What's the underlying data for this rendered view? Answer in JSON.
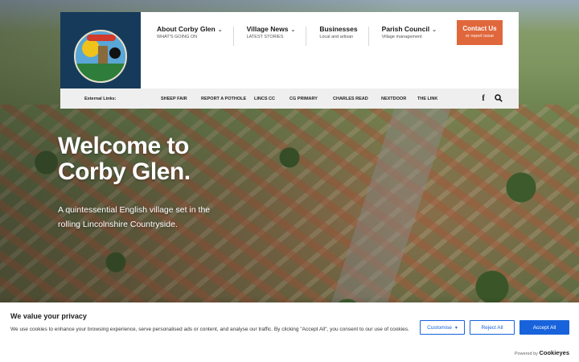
{
  "header": {
    "logo_alt": "Corby Glen village sign",
    "nav": [
      {
        "title": "About Corby Glen",
        "sub": "WHAT'S GOING ON",
        "has_caret": true
      },
      {
        "title": "Village News",
        "sub": "LATEST STORIES",
        "has_caret": true
      },
      {
        "title": "Businesses",
        "sub": "Local and artisan",
        "has_caret": false
      },
      {
        "title": "Parish Council",
        "sub": "Village management",
        "has_caret": true
      }
    ],
    "contact": {
      "title": "Contact Us",
      "sub": "or report issue"
    },
    "external": {
      "label": "External Links:",
      "links": [
        "SHEEP FAIR",
        "Report a pothole",
        "Lincs CC",
        "CG PRIMARY",
        "CHARLES READ",
        "NextDoor",
        "The Link"
      ]
    },
    "icons": [
      "facebook-icon",
      "search-icon"
    ]
  },
  "hero": {
    "title_line1": "Welcome to",
    "title_line2": "Corby Glen.",
    "subtitle": "A quintessential English village set in the rolling Lincolnshire Countryside."
  },
  "cookie": {
    "title": "We value your privacy",
    "text": "We use cookies to enhance your browsing experience, serve personalised ads or content, and analyse our traffic. By clicking \"Accept All\", you consent to our use of cookies.",
    "customise": "Customise",
    "reject": "Reject All",
    "accept": "Accept All",
    "powered_prefix": "Powered by",
    "powered_brand": "Cookieyes"
  },
  "colors": {
    "accent": "#e0673c",
    "brand_navy": "#163a5a",
    "cookie_blue": "#1863dc"
  }
}
